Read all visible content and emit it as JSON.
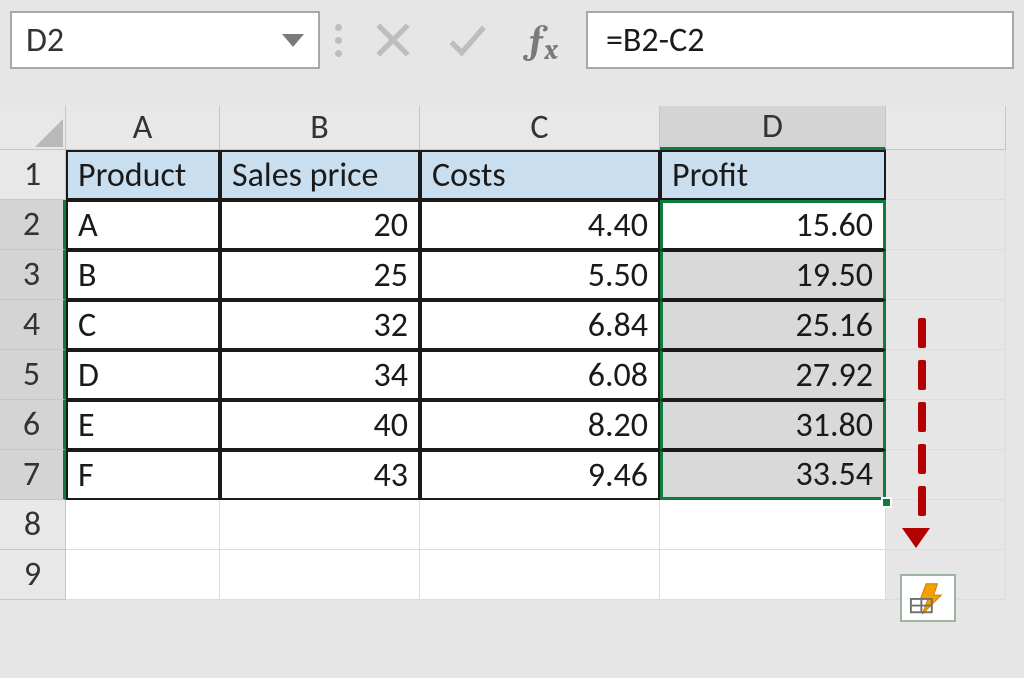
{
  "namebox": {
    "value": "D2"
  },
  "formula_bar": {
    "value": "=B2-C2",
    "fx_label": "ƒx"
  },
  "columns": [
    "A",
    "B",
    "C",
    "D"
  ],
  "rows": [
    "1",
    "2",
    "3",
    "4",
    "5",
    "6",
    "7",
    "8",
    "9"
  ],
  "headers": {
    "A": "Product",
    "B": "Sales price",
    "C": "Costs",
    "D": "Profit"
  },
  "data": [
    {
      "product": "A",
      "sales": "20",
      "costs": "4.40",
      "profit": "15.60"
    },
    {
      "product": "B",
      "sales": "25",
      "costs": "5.50",
      "profit": "19.50"
    },
    {
      "product": "C",
      "sales": "32",
      "costs": "6.84",
      "profit": "25.16"
    },
    {
      "product": "D",
      "sales": "34",
      "costs": "6.08",
      "profit": "27.92"
    },
    {
      "product": "E",
      "sales": "40",
      "costs": "8.20",
      "profit": "31.80"
    },
    {
      "product": "F",
      "sales": "43",
      "costs": "9.46",
      "profit": "33.54"
    }
  ],
  "selection": {
    "active": "D2",
    "range": "D2:D7"
  },
  "chart_data": {
    "type": "table",
    "title": "",
    "columns": [
      "Product",
      "Sales price",
      "Costs",
      "Profit"
    ],
    "rows": [
      [
        "A",
        20,
        4.4,
        15.6
      ],
      [
        "B",
        25,
        5.5,
        19.5
      ],
      [
        "C",
        32,
        6.84,
        25.16
      ],
      [
        "D",
        34,
        6.08,
        27.92
      ],
      [
        "E",
        40,
        8.2,
        31.8
      ],
      [
        "F",
        43,
        9.46,
        33.54
      ]
    ]
  }
}
